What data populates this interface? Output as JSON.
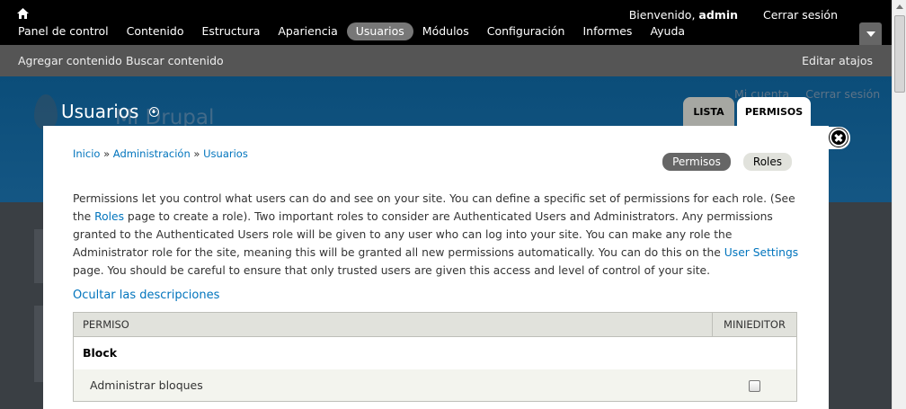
{
  "toolbar": {
    "welcome_prefix": "Bienvenido,",
    "username": "admin",
    "logout": "Cerrar sesión",
    "menu": [
      {
        "label": "Panel de control"
      },
      {
        "label": "Contenido"
      },
      {
        "label": "Estructura"
      },
      {
        "label": "Apariencia"
      },
      {
        "label": "Usuarios",
        "active": true
      },
      {
        "label": "Módulos"
      },
      {
        "label": "Configuración"
      },
      {
        "label": "Informes"
      },
      {
        "label": "Ayuda"
      }
    ]
  },
  "shortcuts": {
    "add_content": "Agregar contenido",
    "find_content": "Buscar contenido",
    "edit_shortcuts": "Editar atajos"
  },
  "site": {
    "name": "Mi Drupal",
    "my_account": "Mi cuenta",
    "logout": "Cerrar sesión"
  },
  "overlay": {
    "title": "Usuarios",
    "tabs": {
      "list": "Lista",
      "permissions": "Permisos"
    },
    "breadcrumb": {
      "home": "Inicio",
      "separator": "»",
      "admin": "Administración",
      "users": "Usuarios"
    },
    "secondary_tabs": {
      "permissions": "Permisos",
      "roles": "Roles"
    },
    "help": {
      "part1": "Permissions let you control what users can do and see on your site. You can define a specific set of permissions for each role. (See the ",
      "roles_link": "Roles",
      "part2": " page to create a role). Two important roles to consider are Authenticated Users and Administrators. Any permissions granted to the Authenticated Users role will be given to any user who can log into your site. You can make any role the Administrator role for the site, meaning this will be granted all new permissions automatically. You can do this on the ",
      "settings_link": "User Settings",
      "part3": " page. You should be careful to ensure that only trusted users are given this access and level of control of your site."
    },
    "toggle_descriptions": "Ocultar las descripciones",
    "table": {
      "col_permission": "Permiso",
      "col_role": "Minieditor",
      "module": "Block",
      "perm_1": "Administrar bloques"
    }
  }
}
